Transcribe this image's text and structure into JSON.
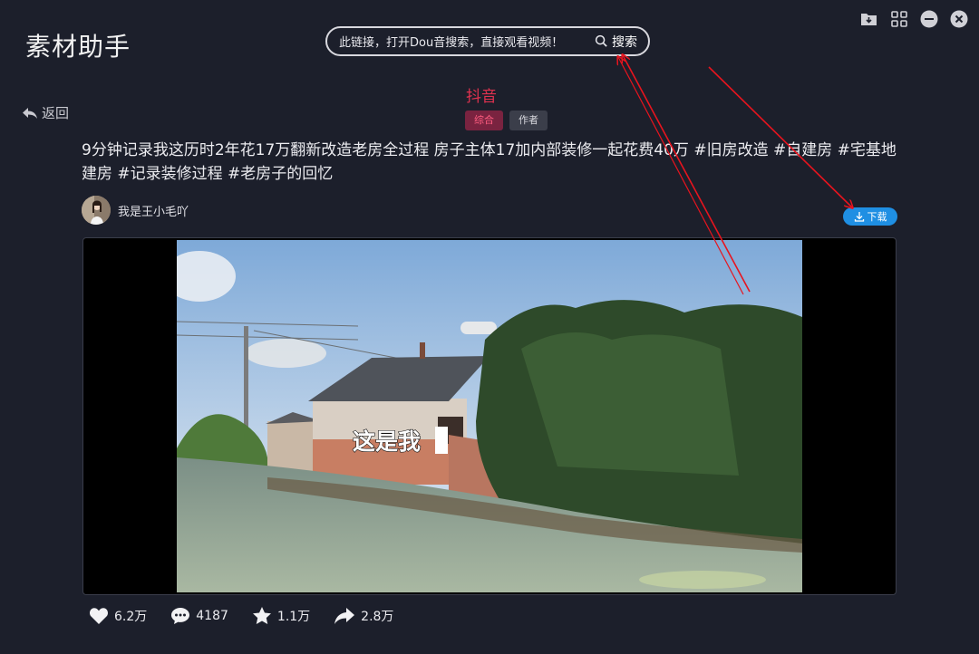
{
  "app": {
    "title": "素材助手"
  },
  "search": {
    "placeholder": "此链接，打开Dou音搜索，直接观看视频！",
    "button_label": "搜索"
  },
  "window_controls": [
    "download-folder-icon",
    "grid-icon",
    "minimize-icon",
    "close-icon"
  ],
  "nav": {
    "back_label": "返回"
  },
  "platform": {
    "name": "抖音",
    "color": "#e0324f"
  },
  "tabs": [
    {
      "label": "综合",
      "active": true
    },
    {
      "label": "作者",
      "active": false
    }
  ],
  "video": {
    "description": "9分钟记录我这历时2年花17万翻新改造老房全过程 房子主体17加内部装修一起花费40万 #旧房改造 #自建房 #宅基地建房 #记录装修过程 #老房子的回忆",
    "author_name": "我是王小毛吖",
    "download_label": "下载",
    "subtitle": "这是我",
    "stats": {
      "likes": "6.2万",
      "comments": "4187",
      "favorites": "1.1万",
      "shares": "2.8万"
    }
  },
  "colors": {
    "background": "#1c1f2b",
    "accent": "#1f8fe3",
    "annotation_arrow": "#e8141e"
  }
}
